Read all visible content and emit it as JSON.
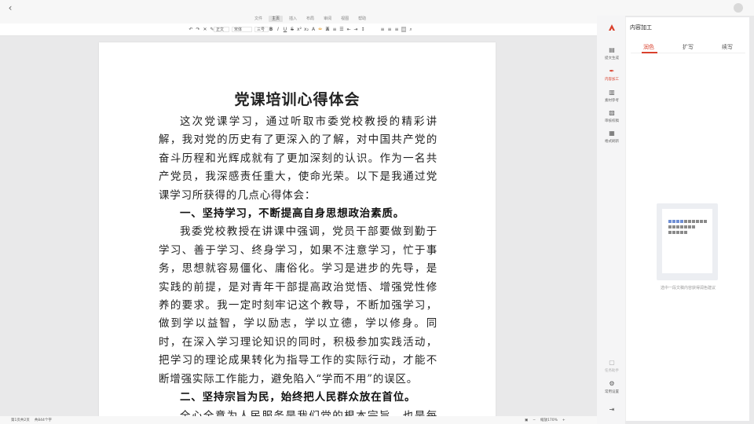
{
  "menu": {
    "tabs": [
      "文件",
      "主页",
      "插入",
      "布局",
      "审阅",
      "视图",
      "帮助"
    ],
    "active_index": 1
  },
  "toolbar": {
    "style_value": "正文",
    "font_value": "宋体",
    "size_value": "三号",
    "icons": [
      "undo-icon",
      "redo-icon",
      "clear-format-icon",
      "format-painter-icon",
      "bold-icon",
      "italic-icon",
      "underline-icon",
      "strikethrough-icon",
      "superscript-icon",
      "subscript-icon",
      "font-color-icon",
      "highlight-icon",
      "bullet-list-icon",
      "numbered-list-icon",
      "indent-icon",
      "align-left-icon",
      "align-center-icon",
      "align-right-icon",
      "search-icon"
    ]
  },
  "document": {
    "title": "党课培训心得体会",
    "paragraphs": [
      {
        "type": "p",
        "text": "这次党课学习，通过听取市委党校教授的精彩讲解，我对党的历史有了更深入的了解，对中国共产党的奋斗历程和光辉成就有了更加深刻的认识。作为一名共产党员，我深感责任重大，使命光荣。以下是我通过党课学习所获得的几点心得体会："
      },
      {
        "type": "h",
        "text": "一、坚持学习，不断提高自身思想政治素质。"
      },
      {
        "type": "p",
        "text": "我委党校教授在讲课中强调，党员干部要做到勤于学习、善于学习、终身学习，如果不注意学习，忙于事务，思想就容易僵化、庸俗化。学习是进步的先导，是实践的前提，是对青年干部提高政治觉悟、增强党性修养的要求。我一定时刻牢记这个教导，不断加强学习，做到学以益智，学以励志，学以立德，学以修身。同时，在深入学习理论知识的同时，积极参加实践活动，把学习的理论成果转化为指导工作的实际行动，才能不断增强实际工作能力，避免陷入“学而不用”的误区。"
      },
      {
        "type": "h",
        "text": "二、坚持宗旨为民，始终把人民群众放在首位。"
      },
      {
        "type": "p",
        "text": "全心全意为人民服务是我们党的根本宗旨，也是每一"
      }
    ]
  },
  "status": {
    "page": "第1页共2页",
    "words": "共844个字",
    "zoom": "缩放170%"
  },
  "rail": {
    "items": [
      {
        "label": "提文生成",
        "icon": "document-generate-icon"
      },
      {
        "label": "内容加工",
        "icon": "content-edit-icon",
        "active": true
      },
      {
        "label": "素材参考",
        "icon": "library-icon"
      },
      {
        "label": "审核校稿",
        "icon": "proofread-icon"
      },
      {
        "label": "格式刷新",
        "icon": "format-icon"
      }
    ],
    "bottom_items": [
      {
        "label": "任务助手",
        "icon": "task-icon"
      },
      {
        "label": "常用设置",
        "icon": "settings-icon"
      }
    ]
  },
  "panel": {
    "title": "内容加工",
    "tabs": [
      "润色",
      "扩写",
      "续写"
    ],
    "active_tab": 0,
    "hint": "选中一段文稿内容获得润色建议"
  },
  "colors": {
    "accent": "#d9412d",
    "bg": "#e9e9ea"
  }
}
